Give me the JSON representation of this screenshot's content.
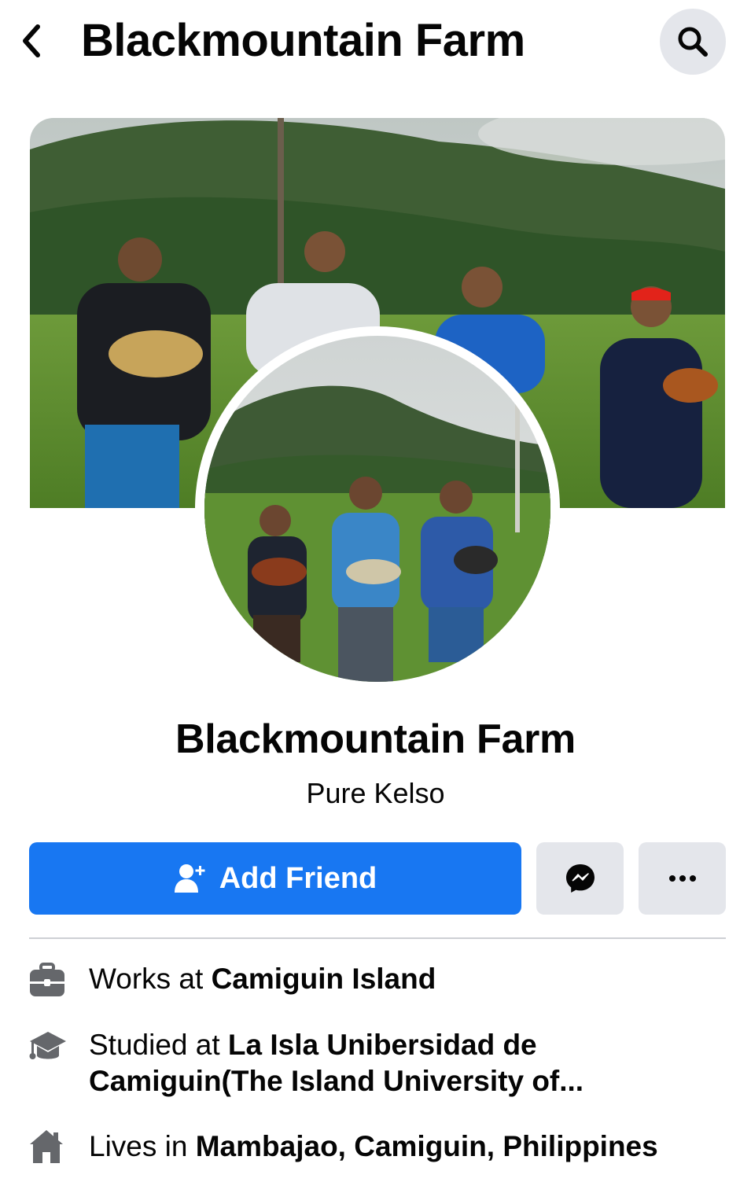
{
  "header": {
    "title": "Blackmountain Farm",
    "back_icon": "chevron-left-icon",
    "search_icon": "search-icon"
  },
  "profile": {
    "name": "Blackmountain Farm",
    "bio": "Pure Kelso",
    "cover_photo": "cover-photo",
    "profile_photo": "profile-photo"
  },
  "actions": {
    "add_friend_label": "Add Friend",
    "add_friend_icon": "add-person-icon",
    "messenger_icon": "messenger-icon",
    "more_icon": "more-horizontal-icon"
  },
  "intro": {
    "work": {
      "prefix": "Works at ",
      "value": "Camiguin Island",
      "icon": "briefcase-icon"
    },
    "education": {
      "prefix": "Studied at ",
      "value_line1": "La Isla Unibersidad de",
      "value_line2": "Camiguin(The Island University of...",
      "icon": "graduation-cap-icon"
    },
    "home": {
      "prefix": "Lives in ",
      "value": "Mambajao, Camiguin, Philippines",
      "icon": "house-icon"
    }
  },
  "colors": {
    "primary": "#1877f2",
    "button_secondary": "#e4e6eb",
    "text": "#050505",
    "divider": "#ced0d4"
  }
}
